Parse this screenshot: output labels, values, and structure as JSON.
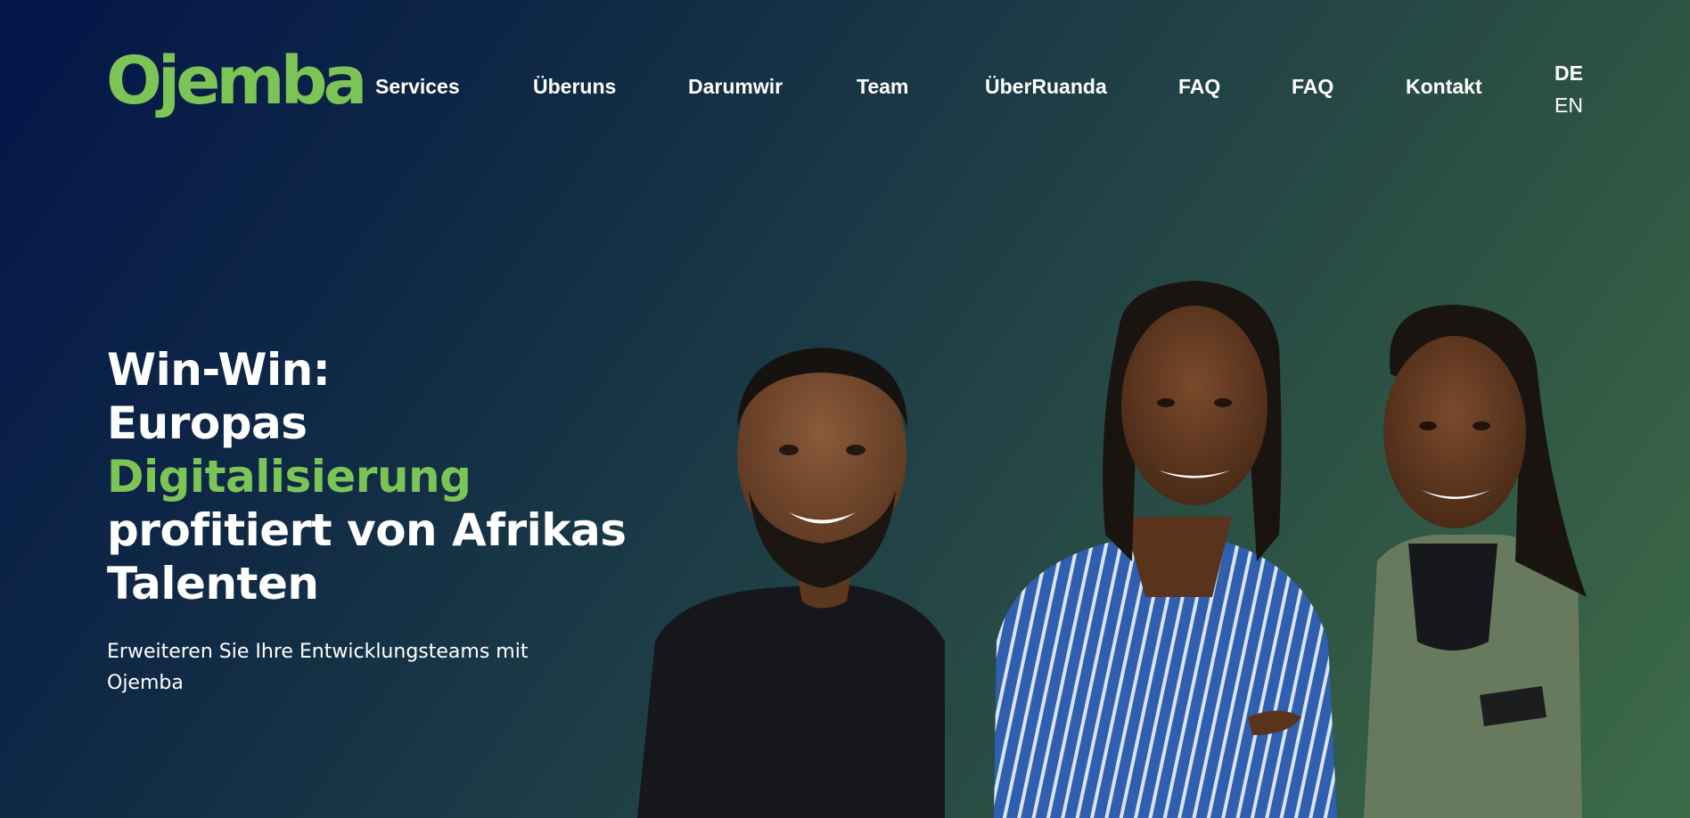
{
  "brand": {
    "name": "Ojemba",
    "accent_color": "#7dc457"
  },
  "nav": {
    "items": [
      {
        "label": "Services"
      },
      {
        "label": "Überuns"
      },
      {
        "label": "Darumwir"
      },
      {
        "label": "Team"
      },
      {
        "label": "ÜberRuanda"
      },
      {
        "label": "FAQ"
      },
      {
        "label": "FAQ"
      },
      {
        "label": "Kontakt"
      }
    ],
    "languages": [
      {
        "code": "DE",
        "active": true
      },
      {
        "code": "EN",
        "active": false
      }
    ]
  },
  "hero": {
    "headline_line1": "Win-Win:",
    "headline_line2": "Europas",
    "headline_highlight": "Digitalisierung",
    "headline_line4": "profitiert von Afrikas",
    "headline_line5": "Talenten",
    "subtext": "Erweiteren Sie Ihre Entwicklungsteams mit Ojemba"
  }
}
